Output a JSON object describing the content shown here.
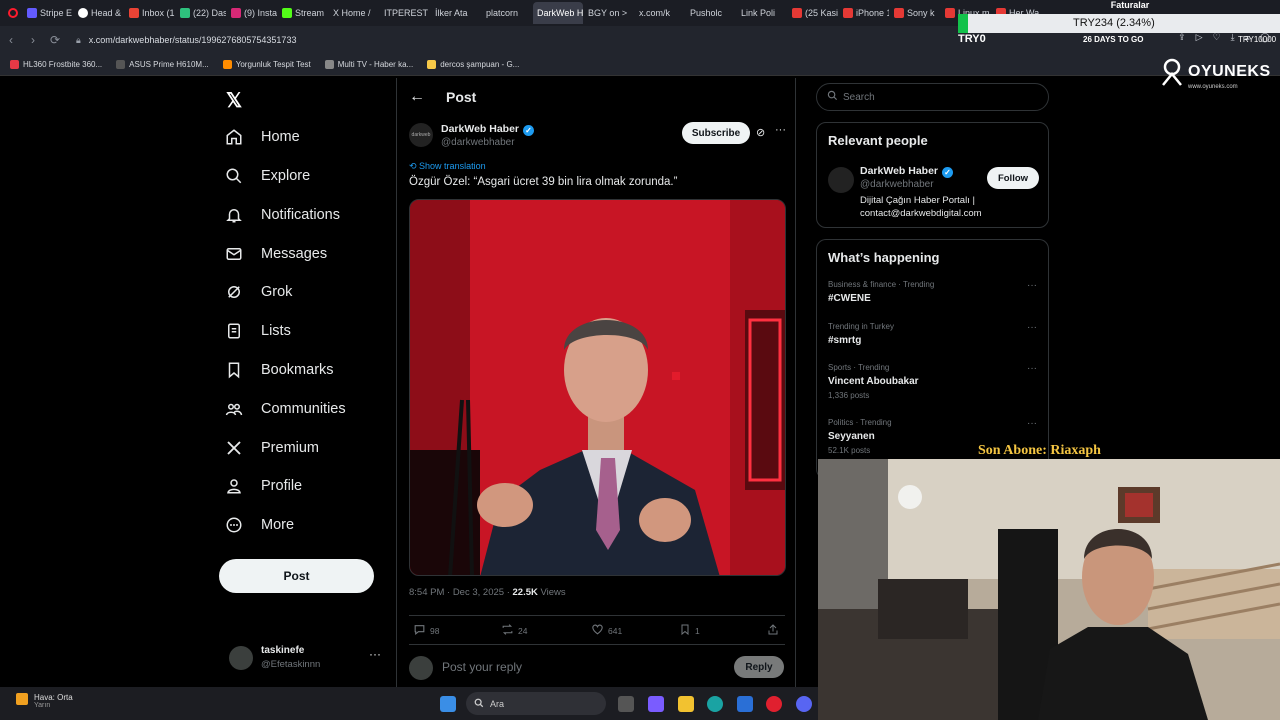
{
  "browser": {
    "tabs": [
      "Stripe E",
      "Head &",
      "Inbox (1",
      "(22) Das",
      "(9) Insta",
      "Stream",
      "X Home /",
      "ITPEREST",
      "İlker Ata",
      "platcorn",
      "DarkWeb Habe",
      "BGY on >",
      "x.com/k",
      "Pusholc",
      "Link Poli",
      "(25 Kasi",
      "iPhone 1",
      "Sony k",
      "Linux m",
      "Her Wa"
    ],
    "active_tab_index": 10,
    "url": "x.com/darkwebhaber/status/1996276805754351733",
    "bookmarks": [
      "HL360 Frostbite 360...",
      "ASUS Prime H610M...",
      "Yorgunluk Tespit Test",
      "Multi TV - Haber ka...",
      "dercos şampuan - G..."
    ]
  },
  "overlay": {
    "finance_label": "Faturalar",
    "ticker": "TRY234 (2.34%)",
    "try_left": "TRY0",
    "days_to_go": "26 DAYS TO GO",
    "try_right": "TRY10000",
    "brand": "OYUNEKS",
    "brand_url": "www.oyuneks.com",
    "son_abone": "Son Abone: Riaxaph"
  },
  "sidebar": {
    "nav": [
      {
        "label": "Home",
        "icon": "home-icon"
      },
      {
        "label": "Explore",
        "icon": "search-icon"
      },
      {
        "label": "Notifications",
        "icon": "bell-icon"
      },
      {
        "label": "Messages",
        "icon": "mail-icon"
      },
      {
        "label": "Grok",
        "icon": "grok-icon"
      },
      {
        "label": "Lists",
        "icon": "list-icon"
      },
      {
        "label": "Bookmarks",
        "icon": "bookmark-icon"
      },
      {
        "label": "Communities",
        "icon": "communities-icon"
      },
      {
        "label": "Premium",
        "icon": "x-premium-icon"
      },
      {
        "label": "Profile",
        "icon": "profile-icon"
      },
      {
        "label": "More",
        "icon": "more-circle-icon"
      }
    ],
    "post_button": "Post",
    "account": {
      "name": "taskinefe",
      "handle": "@Efetaskinnn"
    }
  },
  "post": {
    "header": "Post",
    "author": {
      "name": "DarkWeb Haber",
      "handle": "@darkwebhaber",
      "avatar_text": "darkweb"
    },
    "subscribe": "Subscribe",
    "show_translation": "Show translation",
    "text": "Özgür Özel: “Asgari ücret 39 bin lira olmak zorunda.”",
    "meta": {
      "time": "8:54 PM · Dec 3, 2025 · ",
      "views_count": "22.5K",
      "views_label": " Views"
    },
    "stats": {
      "replies": "98",
      "reposts": "24",
      "likes": "641",
      "bookmarks": "1"
    },
    "reply_placeholder": "Post your reply",
    "reply_button": "Reply"
  },
  "right": {
    "search_placeholder": "Search",
    "relevant_title": "Relevant people",
    "person": {
      "name": "DarkWeb Haber",
      "handle": "@darkwebhaber",
      "bio": "Dijital Çağın Haber Portalı | contact@darkwebdigital.com",
      "follow": "Follow"
    },
    "happening_title": "What’s happening",
    "trends": [
      {
        "context": "Business & finance · Trending",
        "title": "#CWENE",
        "posts": ""
      },
      {
        "context": "Trending in Turkey",
        "title": "#smrtg",
        "posts": ""
      },
      {
        "context": "Sports · Trending",
        "title": "Vincent Aboubakar",
        "posts": "1,336 posts"
      },
      {
        "context": "Politics · Trending",
        "title": "Seyyanen",
        "posts": "52.1K posts"
      }
    ]
  },
  "taskbar": {
    "weather": "Hava: Orta",
    "weather_sub": "Yarın",
    "search": "Ara"
  },
  "colors": {
    "accent": "#1d9bf0",
    "background": "#000000",
    "border": "#2f3336",
    "muted": "#71767b"
  }
}
